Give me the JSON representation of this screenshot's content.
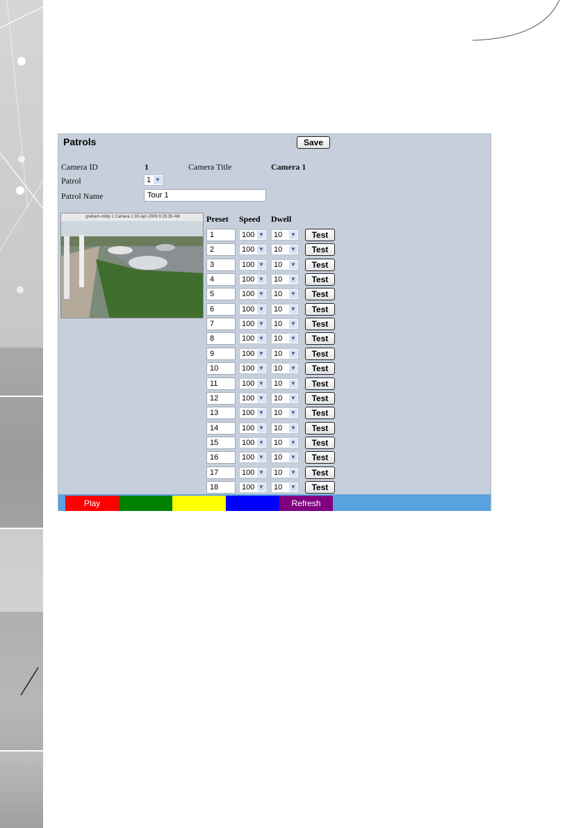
{
  "panel": {
    "title": "Patrols",
    "save_label": "Save"
  },
  "camera": {
    "id_label": "Camera ID",
    "id_value": "1",
    "title_label": "Camera Title",
    "title_value": "Camera 1",
    "patrol_label": "Patrol",
    "patrol_value": "1",
    "patrol_name_label": "Patrol Name",
    "patrol_name_value": "Tour 1",
    "view_caption": "graham-mittp 1 Camera 1 30-Apr-2009 9:25:35 AM"
  },
  "table": {
    "headers": {
      "preset": "Preset",
      "speed": "Speed",
      "dwell": "Dwell"
    },
    "test_label": "Test",
    "rows": [
      {
        "preset": "1",
        "speed": "100",
        "dwell": "10"
      },
      {
        "preset": "2",
        "speed": "100",
        "dwell": "10"
      },
      {
        "preset": "3",
        "speed": "100",
        "dwell": "10"
      },
      {
        "preset": "4",
        "speed": "100",
        "dwell": "10"
      },
      {
        "preset": "5",
        "speed": "100",
        "dwell": "10"
      },
      {
        "preset": "6",
        "speed": "100",
        "dwell": "10"
      },
      {
        "preset": "7",
        "speed": "100",
        "dwell": "10"
      },
      {
        "preset": "8",
        "speed": "100",
        "dwell": "10"
      },
      {
        "preset": "9",
        "speed": "100",
        "dwell": "10"
      },
      {
        "preset": "10",
        "speed": "100",
        "dwell": "10"
      },
      {
        "preset": "11",
        "speed": "100",
        "dwell": "10"
      },
      {
        "preset": "12",
        "speed": "100",
        "dwell": "10"
      },
      {
        "preset": "13",
        "speed": "100",
        "dwell": "10"
      },
      {
        "preset": "14",
        "speed": "100",
        "dwell": "10"
      },
      {
        "preset": "15",
        "speed": "100",
        "dwell": "10"
      },
      {
        "preset": "16",
        "speed": "100",
        "dwell": "10"
      },
      {
        "preset": "17",
        "speed": "100",
        "dwell": "10"
      },
      {
        "preset": "18",
        "speed": "100",
        "dwell": "10"
      }
    ]
  },
  "bottom_bar": {
    "buttons": [
      {
        "label": "Play",
        "color": "#ff0000"
      },
      {
        "label": "",
        "color": "#008000"
      },
      {
        "label": "",
        "color": "#ffff00"
      },
      {
        "label": "",
        "color": "#0000ff"
      },
      {
        "label": "Refresh",
        "color": "#800080"
      }
    ]
  },
  "icons": {
    "dropdown_arrow": "chevron-down-icon"
  }
}
